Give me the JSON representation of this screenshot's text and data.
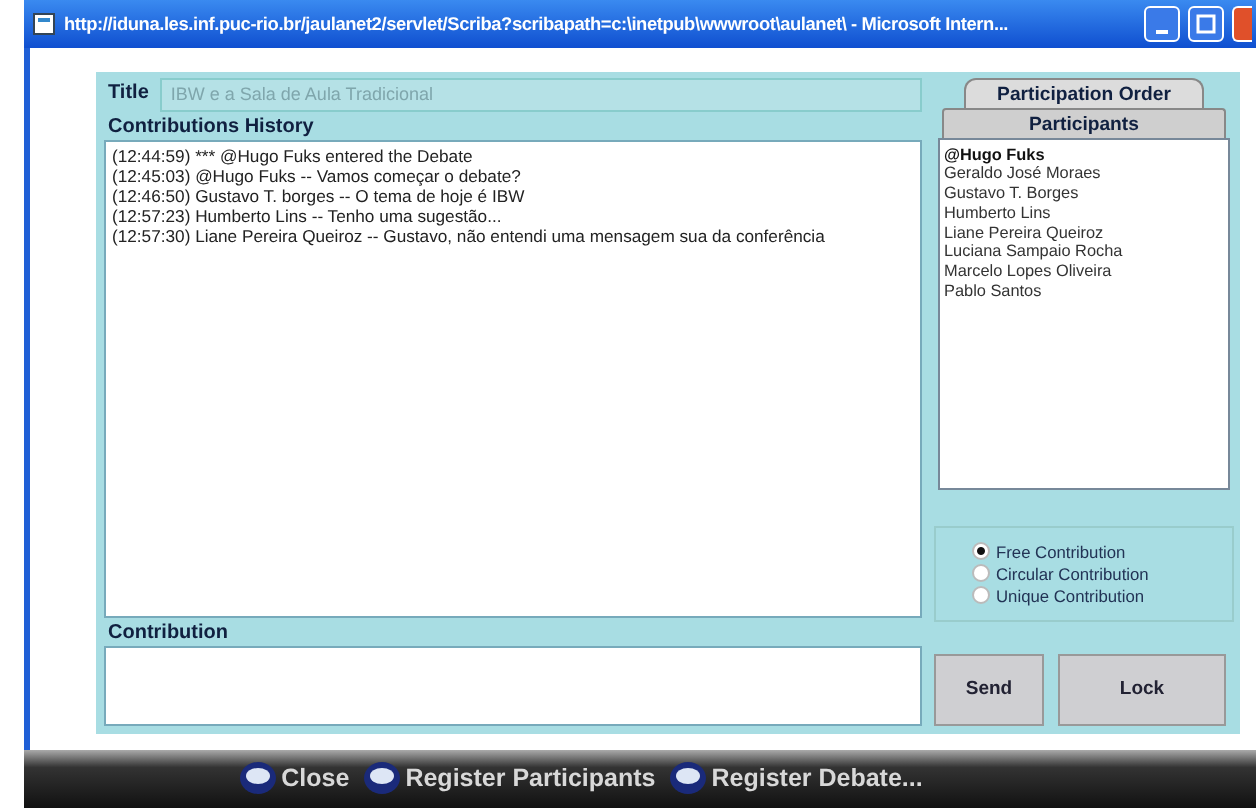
{
  "window": {
    "title": "http://iduna.les.inf.puc-rio.br/jaulanet2/servlet/Scriba?scribapath=c:\\inetpub\\wwwroot\\aulanet\\ - Microsoft Intern..."
  },
  "title_field": {
    "label": "Title",
    "placeholder": "IBW e a Sala de Aula Tradicional"
  },
  "history": {
    "label": "Contributions History",
    "lines": [
      "(12:44:59) *** @Hugo Fuks entered the Debate",
      "(12:45:03) @Hugo Fuks -- Vamos começar o debate?",
      "(12:46:50) Gustavo T. borges -- O tema de hoje é IBW",
      "(12:57:23) Humberto Lins -- Tenho uma sugestão...",
      "(12:57:30) Liane Pereira Queiroz -- Gustavo, não entendi uma mensagem sua da conferência"
    ]
  },
  "tabs": [
    {
      "label": "Participation Order",
      "selected": false
    },
    {
      "label": "Participants",
      "selected": true
    }
  ],
  "participants": [
    {
      "name": "@Hugo Fuks",
      "current": true
    },
    {
      "name": "Geraldo José Moraes",
      "current": false
    },
    {
      "name": "Gustavo T. Borges",
      "current": false
    },
    {
      "name": "Humberto Lins",
      "current": false
    },
    {
      "name": "Liane Pereira Queiroz",
      "current": false
    },
    {
      "name": "Luciana Sampaio Rocha",
      "current": false
    },
    {
      "name": "Marcelo Lopes Oliveira",
      "current": false
    },
    {
      "name": "Pablo Santos",
      "current": false
    }
  ],
  "modes": [
    {
      "label": "Free Contribution",
      "selected": true
    },
    {
      "label": "Circular Contribution",
      "selected": false
    },
    {
      "label": "Unique Contribution",
      "selected": false
    }
  ],
  "contribution": {
    "label": "Contribution"
  },
  "buttons": [
    {
      "label": "Send"
    },
    {
      "label": "Lock"
    }
  ],
  "bottom_links": [
    {
      "label": "Close"
    },
    {
      "label": "Register Participants"
    },
    {
      "label": "Register Debate..."
    }
  ]
}
